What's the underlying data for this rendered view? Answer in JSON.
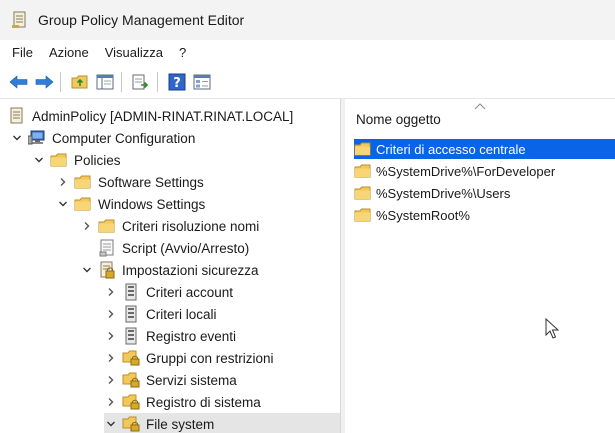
{
  "window": {
    "title": "Group Policy Management Editor"
  },
  "menu": [
    "File",
    "Azione",
    "Visualizza",
    "?"
  ],
  "toolbar": {
    "buttons": [
      "back-arrow-icon",
      "forward-arrow-icon",
      "up-folder-icon",
      "show-hide-tree-icon",
      "export-list-icon",
      "help-icon",
      "properties-icon"
    ]
  },
  "tree": {
    "root": "AdminPolicy [ADMIN-RINAT.RINAT.LOCAL]",
    "computer_configuration": "Computer Configuration",
    "policies": "Policies",
    "software_settings": "Software Settings",
    "windows_settings": "Windows Settings",
    "criteri_risoluzione_nomi": "Criteri risoluzione nomi",
    "script": "Script (Avvio/Arresto)",
    "impostazioni_sicurezza": "Impostazioni sicurezza",
    "criteri_account": "Criteri account",
    "criteri_locali": "Criteri locali",
    "registro_eventi": "Registro eventi",
    "gruppi_con_restrizioni": "Gruppi con restrizioni",
    "servizi_sistema": "Servizi sistema",
    "registro_di_sistema": "Registro di sistema",
    "file_system": "File system"
  },
  "list": {
    "column_header": "Nome oggetto",
    "items": [
      "Criteri di accesso centrale",
      "%SystemDrive%\\ForDeveloper",
      "%SystemDrive%\\Users",
      "%SystemRoot%"
    ],
    "selected_index": 0
  },
  "colors": {
    "selection": "#0a64e6",
    "folder": "#f3c85a",
    "titlebar": "#f3f3f3"
  }
}
